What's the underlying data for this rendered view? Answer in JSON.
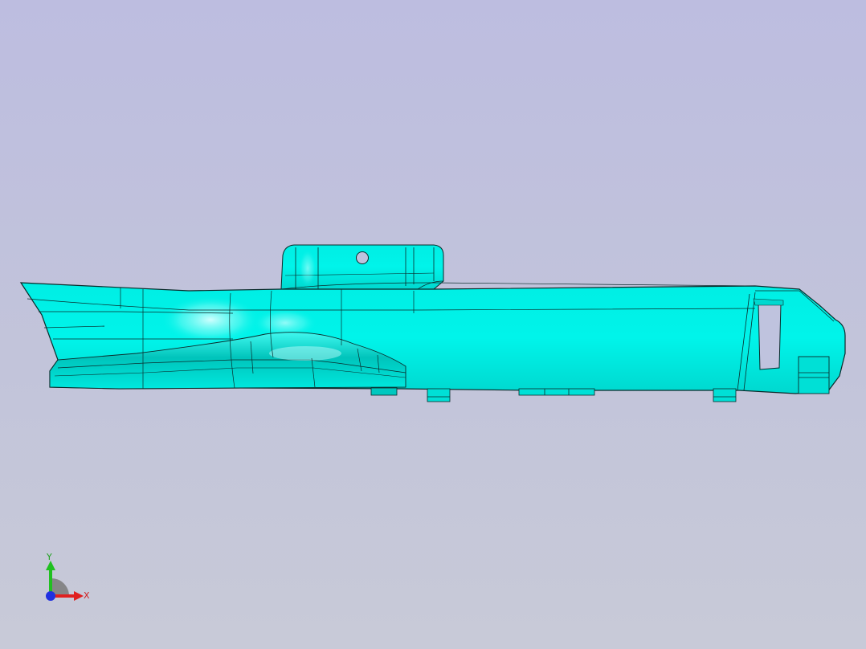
{
  "viewport": {
    "background_top": "#bdbde0",
    "background_bottom": "#c8cad8"
  },
  "model": {
    "surface_color": "#00f0e6",
    "highlight_color": "#c8ffff",
    "shadow_color": "#00b4ac",
    "edge_color": "#0a2a2a"
  },
  "triad": {
    "x_label": "X",
    "y_label": "Y",
    "x_color": "#e02020",
    "y_color": "#20c020",
    "z_color": "#2030e0"
  }
}
